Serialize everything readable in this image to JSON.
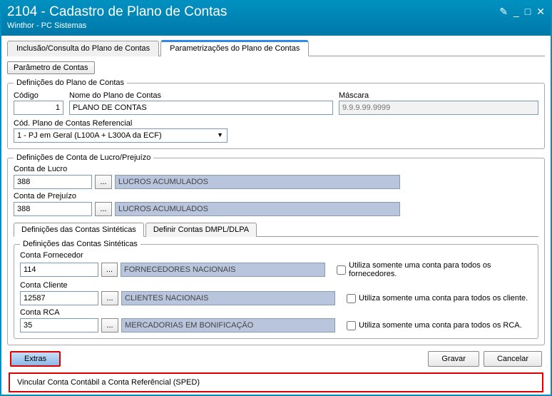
{
  "window": {
    "title": "2104 - Cadastro de Plano de Contas",
    "subtitle": "Winthor - PC Sistemas"
  },
  "tabs": {
    "t1": "Inclusão/Consulta do Plano de Contas",
    "t2": "Parametrizações do Plano de Contas"
  },
  "buttons": {
    "parametro": "Parâmetro de Contas",
    "extras": "Extras",
    "gravar": "Gravar",
    "cancelar": "Cancelar",
    "browse": "..."
  },
  "group_defPlano": {
    "legend": "Definições do Plano de Contas",
    "codigo_label": "Código",
    "codigo_value": "1",
    "nome_label": "Nome do Plano de Contas",
    "nome_value": "PLANO DE CONTAS",
    "mascara_label": "Máscara",
    "mascara_placeholder": "9.9.9.99.9999",
    "codref_label": "Cód. Plano de Contas Referencial",
    "codref_value": "1 - PJ em Geral (L100A + L300A da ECF)"
  },
  "group_lucroPrej": {
    "legend": "Definições de Conta de Lucro/Prejuízo",
    "lucro_label": "Conta de Lucro",
    "lucro_code": "388",
    "lucro_desc": "LUCROS ACUMULADOS",
    "prej_label": "Conta de Prejuízo",
    "prej_code": "388",
    "prej_desc": "LUCROS ACUMULADOS"
  },
  "inner_tabs": {
    "sint": "Definições das Contas Sintéticas",
    "dmpl": "Definir Contas DMPL/DLPA"
  },
  "group_sint": {
    "legend": "Definições das Contas Sintéticas",
    "fornecedor_label": "Conta Fornecedor",
    "fornecedor_code": "114",
    "fornecedor_desc": "FORNECEDORES NACIONAIS",
    "fornecedor_chk": "Utiliza somente uma conta para todos os fornecedores.",
    "cliente_label": "Conta Cliente",
    "cliente_code": "12587",
    "cliente_desc": "CLIENTES NACIONAIS",
    "cliente_chk": "Utiliza somente uma conta para todos os cliente.",
    "rca_label": "Conta RCA",
    "rca_code": "35",
    "rca_desc": "MERCADORIAS EM BONIFICAÇÃO",
    "rca_chk": "Utiliza somente uma conta para todos os RCA."
  },
  "dropdown": {
    "item1": "Vincular Conta Contábil a Conta Referêncial (SPED)"
  }
}
